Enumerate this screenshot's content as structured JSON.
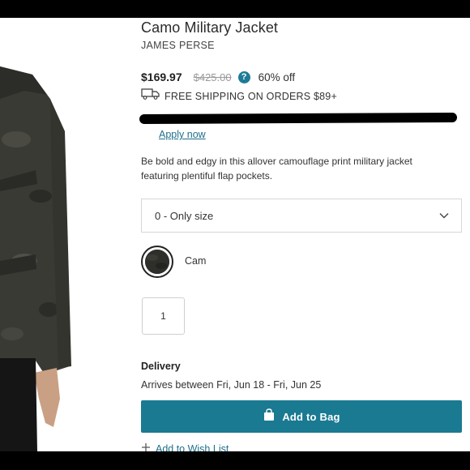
{
  "product": {
    "title": "Camo Military Jacket",
    "brand": "JAMES PERSE",
    "price": "$169.97",
    "original_price": "$425.00",
    "help_icon_glyph": "?",
    "discount": "60% off",
    "shipping_text": "FREE SHIPPING ON ORDERS $89+",
    "apply_link": "Apply now",
    "description": "Be bold and edgy in this allover camouflage print military jacket featuring plentiful flap pockets."
  },
  "size": {
    "selected": "0 - Only size"
  },
  "color": {
    "selected": "Cam"
  },
  "quantity": {
    "value": "1"
  },
  "delivery": {
    "heading": "Delivery",
    "text": "Arrives between Fri, Jun 18 - Fri, Jun 25"
  },
  "actions": {
    "add_to_bag": "Add to Bag",
    "wish_list": "Add to Wish List"
  },
  "colors": {
    "accent": "#1a7a91",
    "link": "#1e6f8c",
    "help_badge": "#1e7b98"
  },
  "icons": {
    "help": "question-circle-icon",
    "shipping": "truck-icon",
    "select_arrow": "chevron-down-icon",
    "bag": "shopping-bag-icon",
    "wish": "plus-icon"
  }
}
